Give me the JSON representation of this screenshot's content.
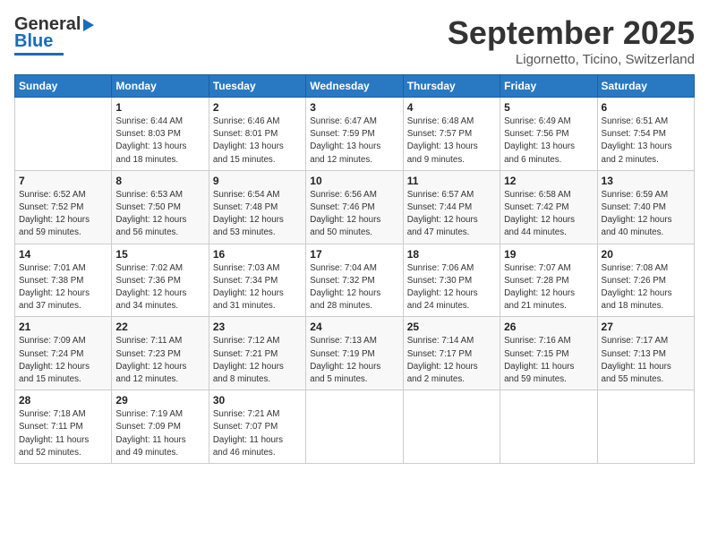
{
  "header": {
    "logo_general": "General",
    "logo_blue": "Blue",
    "month": "September 2025",
    "location": "Ligornetto, Ticino, Switzerland"
  },
  "weekdays": [
    "Sunday",
    "Monday",
    "Tuesday",
    "Wednesday",
    "Thursday",
    "Friday",
    "Saturday"
  ],
  "weeks": [
    [
      {
        "day": "",
        "info": ""
      },
      {
        "day": "1",
        "info": "Sunrise: 6:44 AM\nSunset: 8:03 PM\nDaylight: 13 hours\nand 18 minutes."
      },
      {
        "day": "2",
        "info": "Sunrise: 6:46 AM\nSunset: 8:01 PM\nDaylight: 13 hours\nand 15 minutes."
      },
      {
        "day": "3",
        "info": "Sunrise: 6:47 AM\nSunset: 7:59 PM\nDaylight: 13 hours\nand 12 minutes."
      },
      {
        "day": "4",
        "info": "Sunrise: 6:48 AM\nSunset: 7:57 PM\nDaylight: 13 hours\nand 9 minutes."
      },
      {
        "day": "5",
        "info": "Sunrise: 6:49 AM\nSunset: 7:56 PM\nDaylight: 13 hours\nand 6 minutes."
      },
      {
        "day": "6",
        "info": "Sunrise: 6:51 AM\nSunset: 7:54 PM\nDaylight: 13 hours\nand 2 minutes."
      }
    ],
    [
      {
        "day": "7",
        "info": "Sunrise: 6:52 AM\nSunset: 7:52 PM\nDaylight: 12 hours\nand 59 minutes."
      },
      {
        "day": "8",
        "info": "Sunrise: 6:53 AM\nSunset: 7:50 PM\nDaylight: 12 hours\nand 56 minutes."
      },
      {
        "day": "9",
        "info": "Sunrise: 6:54 AM\nSunset: 7:48 PM\nDaylight: 12 hours\nand 53 minutes."
      },
      {
        "day": "10",
        "info": "Sunrise: 6:56 AM\nSunset: 7:46 PM\nDaylight: 12 hours\nand 50 minutes."
      },
      {
        "day": "11",
        "info": "Sunrise: 6:57 AM\nSunset: 7:44 PM\nDaylight: 12 hours\nand 47 minutes."
      },
      {
        "day": "12",
        "info": "Sunrise: 6:58 AM\nSunset: 7:42 PM\nDaylight: 12 hours\nand 44 minutes."
      },
      {
        "day": "13",
        "info": "Sunrise: 6:59 AM\nSunset: 7:40 PM\nDaylight: 12 hours\nand 40 minutes."
      }
    ],
    [
      {
        "day": "14",
        "info": "Sunrise: 7:01 AM\nSunset: 7:38 PM\nDaylight: 12 hours\nand 37 minutes."
      },
      {
        "day": "15",
        "info": "Sunrise: 7:02 AM\nSunset: 7:36 PM\nDaylight: 12 hours\nand 34 minutes."
      },
      {
        "day": "16",
        "info": "Sunrise: 7:03 AM\nSunset: 7:34 PM\nDaylight: 12 hours\nand 31 minutes."
      },
      {
        "day": "17",
        "info": "Sunrise: 7:04 AM\nSunset: 7:32 PM\nDaylight: 12 hours\nand 28 minutes."
      },
      {
        "day": "18",
        "info": "Sunrise: 7:06 AM\nSunset: 7:30 PM\nDaylight: 12 hours\nand 24 minutes."
      },
      {
        "day": "19",
        "info": "Sunrise: 7:07 AM\nSunset: 7:28 PM\nDaylight: 12 hours\nand 21 minutes."
      },
      {
        "day": "20",
        "info": "Sunrise: 7:08 AM\nSunset: 7:26 PM\nDaylight: 12 hours\nand 18 minutes."
      }
    ],
    [
      {
        "day": "21",
        "info": "Sunrise: 7:09 AM\nSunset: 7:24 PM\nDaylight: 12 hours\nand 15 minutes."
      },
      {
        "day": "22",
        "info": "Sunrise: 7:11 AM\nSunset: 7:23 PM\nDaylight: 12 hours\nand 12 minutes."
      },
      {
        "day": "23",
        "info": "Sunrise: 7:12 AM\nSunset: 7:21 PM\nDaylight: 12 hours\nand 8 minutes."
      },
      {
        "day": "24",
        "info": "Sunrise: 7:13 AM\nSunset: 7:19 PM\nDaylight: 12 hours\nand 5 minutes."
      },
      {
        "day": "25",
        "info": "Sunrise: 7:14 AM\nSunset: 7:17 PM\nDaylight: 12 hours\nand 2 minutes."
      },
      {
        "day": "26",
        "info": "Sunrise: 7:16 AM\nSunset: 7:15 PM\nDaylight: 11 hours\nand 59 minutes."
      },
      {
        "day": "27",
        "info": "Sunrise: 7:17 AM\nSunset: 7:13 PM\nDaylight: 11 hours\nand 55 minutes."
      }
    ],
    [
      {
        "day": "28",
        "info": "Sunrise: 7:18 AM\nSunset: 7:11 PM\nDaylight: 11 hours\nand 52 minutes."
      },
      {
        "day": "29",
        "info": "Sunrise: 7:19 AM\nSunset: 7:09 PM\nDaylight: 11 hours\nand 49 minutes."
      },
      {
        "day": "30",
        "info": "Sunrise: 7:21 AM\nSunset: 7:07 PM\nDaylight: 11 hours\nand 46 minutes."
      },
      {
        "day": "",
        "info": ""
      },
      {
        "day": "",
        "info": ""
      },
      {
        "day": "",
        "info": ""
      },
      {
        "day": "",
        "info": ""
      }
    ]
  ]
}
